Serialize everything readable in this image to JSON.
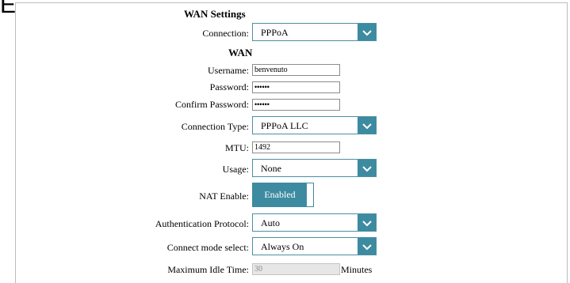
{
  "section_title": "WAN Settings",
  "subsection_title": "WAN",
  "fields": {
    "connection": {
      "label": "Connection:",
      "value": "PPPoA"
    },
    "username": {
      "label": "Username:",
      "value": "benvenuto"
    },
    "password": {
      "label": "Password:",
      "value": "••••••"
    },
    "confirm_password": {
      "label": "Confirm Password:",
      "value": "••••••"
    },
    "connection_type": {
      "label": "Connection Type:",
      "value": "PPPoA LLC"
    },
    "mtu": {
      "label": "MTU:",
      "value": "1492"
    },
    "usage": {
      "label": "Usage:",
      "value": "None"
    },
    "nat_enable": {
      "label": "NAT Enable:",
      "value": "Enabled"
    },
    "auth_protocol": {
      "label": "Authentication Protocol:",
      "value": "Auto"
    },
    "connect_mode": {
      "label": "Connect mode select:",
      "value": "Always On"
    },
    "max_idle_time": {
      "label": "Maximum Idle Time:",
      "value": "30",
      "unit": "Minutes"
    }
  },
  "colors": {
    "accent": "#3d8ba0",
    "select_border": "#4a8fa0",
    "disabled_bg": "#e6e6e6"
  },
  "icons": {
    "dropdown": "chevron-down-icon"
  }
}
